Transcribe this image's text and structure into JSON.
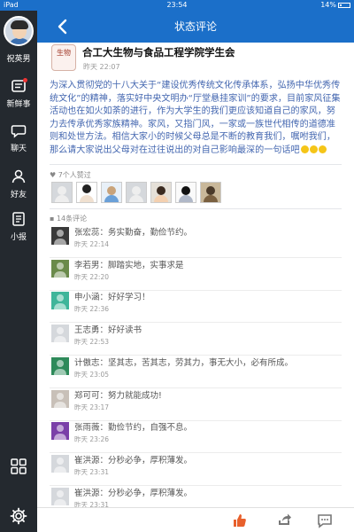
{
  "status": {
    "device": "iPad",
    "time": "23:54",
    "battery": "14%"
  },
  "sidebar": {
    "username": "祝英男",
    "items": [
      {
        "label": "新鲜事",
        "icon": "news-icon",
        "badge": true
      },
      {
        "label": "聊天",
        "icon": "chat-icon"
      },
      {
        "label": "好友",
        "icon": "friends-icon"
      },
      {
        "label": "小报",
        "icon": "newspaper-icon"
      }
    ]
  },
  "header": {
    "title": "状态评论"
  },
  "post": {
    "logo_text": "生物",
    "author": "合工大生物与食品工程学院学生会",
    "time": "昨天 22:07",
    "body": "为深入贯彻党的十八大关于“建设优秀传统文化传承体系，弘扬中华优秀传统文化”的精神，落实好中央文明办“厅堂悬挂家训”的要求，目前家风征集活动也在如火如荼的进行，作为大学生的我们更应该知道自己的家风，努力去传承优秀家族精神。家风，又指门风，一家或一族世代相传的道德准则和处世方法。相信大家小的时候父母总是不断的教育我们，嘱咐我们，那么请大家说出父母对在过往说出的对自己影响最深的一句话吧"
  },
  "likes": {
    "header": "7个人赞过",
    "count": 7
  },
  "comments_header": "14条评论",
  "comments": [
    {
      "name": "张宏蕊",
      "text": "务实勤奋，勤俭节约。",
      "time": "昨天 22:14",
      "avatar_color": "#3a3a3a"
    },
    {
      "name": "李若男",
      "text": "脚踏实地，实事求是",
      "time": "昨天 22:20",
      "avatar_color": "#6a8a4a"
    },
    {
      "name": "申小涵",
      "text": "好好学习！",
      "time": "昨天 22:36",
      "avatar_color": "#3fb59a"
    },
    {
      "name": "王志勇",
      "text": "好好读书",
      "time": "昨天 22:53",
      "avatar_color": "#d5d8dc"
    },
    {
      "name": "计傲志",
      "text": "坚其志，苦其志，劳其力，事无大小，必有所成。",
      "time": "昨天 23:05",
      "avatar_color": "#2e8a5a"
    },
    {
      "name": "郑可可",
      "text": "努力就能成功!",
      "time": "昨天 23:17",
      "avatar_color": "#c8c0b8"
    },
    {
      "name": "张雨薇",
      "text": "勤俭节约，自强不息。",
      "time": "昨天 23:26",
      "avatar_color": "#7a3fa8"
    },
    {
      "name": "崔洪源",
      "text": "分秒必争，厚积薄发。",
      "time": "昨天 23:31",
      "avatar_color": "#d5d8dc"
    },
    {
      "name": "崔洪源",
      "text": "分秒必争，厚积薄发。",
      "time": "昨天 23:31",
      "avatar_color": "#d5d8dc"
    }
  ]
}
